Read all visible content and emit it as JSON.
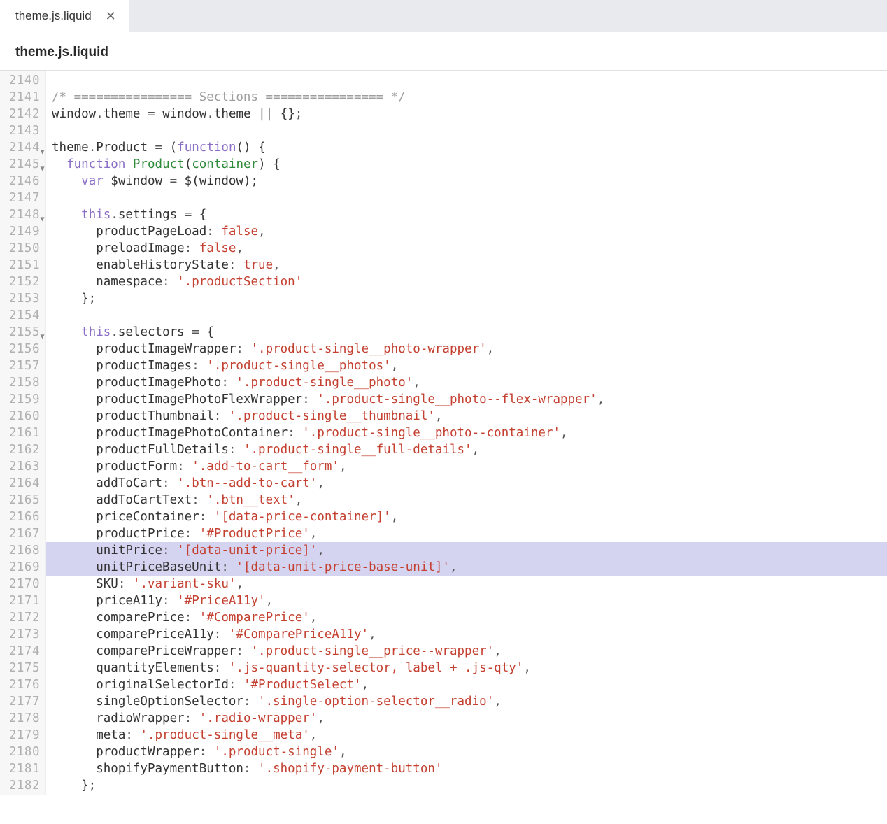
{
  "tab": {
    "label": "theme.js.liquid"
  },
  "breadcrumb": {
    "title": "theme.js.liquid"
  },
  "editor": {
    "highlighted_lines": [
      2168,
      2169
    ],
    "fold_lines": [
      2144,
      2145,
      2148,
      2155
    ],
    "lines": [
      {
        "n": 2140,
        "tokens": []
      },
      {
        "n": 2141,
        "tokens": [
          {
            "t": "/* ================ Sections ================ */",
            "c": "comment"
          }
        ]
      },
      {
        "n": 2142,
        "tokens": [
          {
            "t": "window",
            "c": "plain"
          },
          {
            "t": ".",
            "c": "op"
          },
          {
            "t": "theme",
            "c": "plain"
          },
          {
            "t": " ",
            "c": "plain"
          },
          {
            "t": "=",
            "c": "op"
          },
          {
            "t": " ",
            "c": "plain"
          },
          {
            "t": "window",
            "c": "plain"
          },
          {
            "t": ".",
            "c": "op"
          },
          {
            "t": "theme",
            "c": "plain"
          },
          {
            "t": " ",
            "c": "plain"
          },
          {
            "t": "||",
            "c": "op"
          },
          {
            "t": " ",
            "c": "plain"
          },
          {
            "t": "{}",
            "c": "plain"
          },
          {
            "t": ";",
            "c": "op"
          }
        ]
      },
      {
        "n": 2143,
        "tokens": []
      },
      {
        "n": 2144,
        "tokens": [
          {
            "t": "theme",
            "c": "plain"
          },
          {
            "t": ".",
            "c": "op"
          },
          {
            "t": "Product",
            "c": "plain"
          },
          {
            "t": " ",
            "c": "plain"
          },
          {
            "t": "=",
            "c": "op"
          },
          {
            "t": " ",
            "c": "plain"
          },
          {
            "t": "(",
            "c": "plain"
          },
          {
            "t": "function",
            "c": "kw"
          },
          {
            "t": "() {",
            "c": "plain"
          }
        ]
      },
      {
        "n": 2145,
        "tokens": [
          {
            "t": "  ",
            "c": "plain"
          },
          {
            "t": "function",
            "c": "kw"
          },
          {
            "t": " ",
            "c": "plain"
          },
          {
            "t": "Product",
            "c": "fn"
          },
          {
            "t": "(",
            "c": "plain"
          },
          {
            "t": "container",
            "c": "fn"
          },
          {
            "t": ") {",
            "c": "plain"
          }
        ]
      },
      {
        "n": 2146,
        "tokens": [
          {
            "t": "    ",
            "c": "plain"
          },
          {
            "t": "var",
            "c": "kw"
          },
          {
            "t": " $window ",
            "c": "plain"
          },
          {
            "t": "=",
            "c": "op"
          },
          {
            "t": " $(window);",
            "c": "plain"
          }
        ]
      },
      {
        "n": 2147,
        "tokens": []
      },
      {
        "n": 2148,
        "tokens": [
          {
            "t": "    ",
            "c": "plain"
          },
          {
            "t": "this",
            "c": "kw"
          },
          {
            "t": ".",
            "c": "op"
          },
          {
            "t": "settings ",
            "c": "plain"
          },
          {
            "t": "=",
            "c": "op"
          },
          {
            "t": " {",
            "c": "plain"
          }
        ]
      },
      {
        "n": 2149,
        "tokens": [
          {
            "t": "      productPageLoad",
            "c": "plain"
          },
          {
            "t": ":",
            "c": "op"
          },
          {
            "t": " ",
            "c": "plain"
          },
          {
            "t": "false",
            "c": "const"
          },
          {
            "t": ",",
            "c": "op"
          }
        ]
      },
      {
        "n": 2150,
        "tokens": [
          {
            "t": "      preloadImage",
            "c": "plain"
          },
          {
            "t": ":",
            "c": "op"
          },
          {
            "t": " ",
            "c": "plain"
          },
          {
            "t": "false",
            "c": "const"
          },
          {
            "t": ",",
            "c": "op"
          }
        ]
      },
      {
        "n": 2151,
        "tokens": [
          {
            "t": "      enableHistoryState",
            "c": "plain"
          },
          {
            "t": ":",
            "c": "op"
          },
          {
            "t": " ",
            "c": "plain"
          },
          {
            "t": "true",
            "c": "const"
          },
          {
            "t": ",",
            "c": "op"
          }
        ]
      },
      {
        "n": 2152,
        "tokens": [
          {
            "t": "      namespace",
            "c": "plain"
          },
          {
            "t": ":",
            "c": "op"
          },
          {
            "t": " ",
            "c": "plain"
          },
          {
            "t": "'.productSection'",
            "c": "str"
          }
        ]
      },
      {
        "n": 2153,
        "tokens": [
          {
            "t": "    };",
            "c": "plain"
          }
        ]
      },
      {
        "n": 2154,
        "tokens": []
      },
      {
        "n": 2155,
        "tokens": [
          {
            "t": "    ",
            "c": "plain"
          },
          {
            "t": "this",
            "c": "kw"
          },
          {
            "t": ".",
            "c": "op"
          },
          {
            "t": "selectors ",
            "c": "plain"
          },
          {
            "t": "=",
            "c": "op"
          },
          {
            "t": " {",
            "c": "plain"
          }
        ]
      },
      {
        "n": 2156,
        "tokens": [
          {
            "t": "      productImageWrapper",
            "c": "plain"
          },
          {
            "t": ":",
            "c": "op"
          },
          {
            "t": " ",
            "c": "plain"
          },
          {
            "t": "'.product-single__photo-wrapper'",
            "c": "str"
          },
          {
            "t": ",",
            "c": "op"
          }
        ]
      },
      {
        "n": 2157,
        "tokens": [
          {
            "t": "      productImages",
            "c": "plain"
          },
          {
            "t": ":",
            "c": "op"
          },
          {
            "t": " ",
            "c": "plain"
          },
          {
            "t": "'.product-single__photos'",
            "c": "str"
          },
          {
            "t": ",",
            "c": "op"
          }
        ]
      },
      {
        "n": 2158,
        "tokens": [
          {
            "t": "      productImagePhoto",
            "c": "plain"
          },
          {
            "t": ":",
            "c": "op"
          },
          {
            "t": " ",
            "c": "plain"
          },
          {
            "t": "'.product-single__photo'",
            "c": "str"
          },
          {
            "t": ",",
            "c": "op"
          }
        ]
      },
      {
        "n": 2159,
        "tokens": [
          {
            "t": "      productImagePhotoFlexWrapper",
            "c": "plain"
          },
          {
            "t": ":",
            "c": "op"
          },
          {
            "t": " ",
            "c": "plain"
          },
          {
            "t": "'.product-single__photo--flex-wrapper'",
            "c": "str"
          },
          {
            "t": ",",
            "c": "op"
          }
        ]
      },
      {
        "n": 2160,
        "tokens": [
          {
            "t": "      productThumbnail",
            "c": "plain"
          },
          {
            "t": ":",
            "c": "op"
          },
          {
            "t": " ",
            "c": "plain"
          },
          {
            "t": "'.product-single__thumbnail'",
            "c": "str"
          },
          {
            "t": ",",
            "c": "op"
          }
        ]
      },
      {
        "n": 2161,
        "tokens": [
          {
            "t": "      productImagePhotoContainer",
            "c": "plain"
          },
          {
            "t": ":",
            "c": "op"
          },
          {
            "t": " ",
            "c": "plain"
          },
          {
            "t": "'.product-single__photo--container'",
            "c": "str"
          },
          {
            "t": ",",
            "c": "op"
          }
        ]
      },
      {
        "n": 2162,
        "tokens": [
          {
            "t": "      productFullDetails",
            "c": "plain"
          },
          {
            "t": ":",
            "c": "op"
          },
          {
            "t": " ",
            "c": "plain"
          },
          {
            "t": "'.product-single__full-details'",
            "c": "str"
          },
          {
            "t": ",",
            "c": "op"
          }
        ]
      },
      {
        "n": 2163,
        "tokens": [
          {
            "t": "      productForm",
            "c": "plain"
          },
          {
            "t": ":",
            "c": "op"
          },
          {
            "t": " ",
            "c": "plain"
          },
          {
            "t": "'.add-to-cart__form'",
            "c": "str"
          },
          {
            "t": ",",
            "c": "op"
          }
        ]
      },
      {
        "n": 2164,
        "tokens": [
          {
            "t": "      addToCart",
            "c": "plain"
          },
          {
            "t": ":",
            "c": "op"
          },
          {
            "t": " ",
            "c": "plain"
          },
          {
            "t": "'.btn--add-to-cart'",
            "c": "str"
          },
          {
            "t": ",",
            "c": "op"
          }
        ]
      },
      {
        "n": 2165,
        "tokens": [
          {
            "t": "      addToCartText",
            "c": "plain"
          },
          {
            "t": ":",
            "c": "op"
          },
          {
            "t": " ",
            "c": "plain"
          },
          {
            "t": "'.btn__text'",
            "c": "str"
          },
          {
            "t": ",",
            "c": "op"
          }
        ]
      },
      {
        "n": 2166,
        "tokens": [
          {
            "t": "      priceContainer",
            "c": "plain"
          },
          {
            "t": ":",
            "c": "op"
          },
          {
            "t": " ",
            "c": "plain"
          },
          {
            "t": "'[data-price-container]'",
            "c": "str"
          },
          {
            "t": ",",
            "c": "op"
          }
        ]
      },
      {
        "n": 2167,
        "tokens": [
          {
            "t": "      productPrice",
            "c": "plain"
          },
          {
            "t": ":",
            "c": "op"
          },
          {
            "t": " ",
            "c": "plain"
          },
          {
            "t": "'#ProductPrice'",
            "c": "str"
          },
          {
            "t": ",",
            "c": "op"
          }
        ]
      },
      {
        "n": 2168,
        "tokens": [
          {
            "t": "      unitPrice",
            "c": "plain"
          },
          {
            "t": ":",
            "c": "op"
          },
          {
            "t": " ",
            "c": "plain"
          },
          {
            "t": "'[data-unit-price]'",
            "c": "str"
          },
          {
            "t": ",",
            "c": "op"
          }
        ]
      },
      {
        "n": 2169,
        "tokens": [
          {
            "t": "      unitPriceBaseUnit",
            "c": "plain"
          },
          {
            "t": ":",
            "c": "op"
          },
          {
            "t": " ",
            "c": "plain"
          },
          {
            "t": "'[data-unit-price-base-unit]'",
            "c": "str"
          },
          {
            "t": ",",
            "c": "op"
          }
        ]
      },
      {
        "n": 2170,
        "tokens": [
          {
            "t": "      SKU",
            "c": "plain"
          },
          {
            "t": ":",
            "c": "op"
          },
          {
            "t": " ",
            "c": "plain"
          },
          {
            "t": "'.variant-sku'",
            "c": "str"
          },
          {
            "t": ",",
            "c": "op"
          }
        ]
      },
      {
        "n": 2171,
        "tokens": [
          {
            "t": "      priceA11y",
            "c": "plain"
          },
          {
            "t": ":",
            "c": "op"
          },
          {
            "t": " ",
            "c": "plain"
          },
          {
            "t": "'#PriceA11y'",
            "c": "str"
          },
          {
            "t": ",",
            "c": "op"
          }
        ]
      },
      {
        "n": 2172,
        "tokens": [
          {
            "t": "      comparePrice",
            "c": "plain"
          },
          {
            "t": ":",
            "c": "op"
          },
          {
            "t": " ",
            "c": "plain"
          },
          {
            "t": "'#ComparePrice'",
            "c": "str"
          },
          {
            "t": ",",
            "c": "op"
          }
        ]
      },
      {
        "n": 2173,
        "tokens": [
          {
            "t": "      comparePriceA11y",
            "c": "plain"
          },
          {
            "t": ":",
            "c": "op"
          },
          {
            "t": " ",
            "c": "plain"
          },
          {
            "t": "'#ComparePriceA11y'",
            "c": "str"
          },
          {
            "t": ",",
            "c": "op"
          }
        ]
      },
      {
        "n": 2174,
        "tokens": [
          {
            "t": "      comparePriceWrapper",
            "c": "plain"
          },
          {
            "t": ":",
            "c": "op"
          },
          {
            "t": " ",
            "c": "plain"
          },
          {
            "t": "'.product-single__price--wrapper'",
            "c": "str"
          },
          {
            "t": ",",
            "c": "op"
          }
        ]
      },
      {
        "n": 2175,
        "tokens": [
          {
            "t": "      quantityElements",
            "c": "plain"
          },
          {
            "t": ":",
            "c": "op"
          },
          {
            "t": " ",
            "c": "plain"
          },
          {
            "t": "'.js-quantity-selector, label + .js-qty'",
            "c": "str"
          },
          {
            "t": ",",
            "c": "op"
          }
        ]
      },
      {
        "n": 2176,
        "tokens": [
          {
            "t": "      originalSelectorId",
            "c": "plain"
          },
          {
            "t": ":",
            "c": "op"
          },
          {
            "t": " ",
            "c": "plain"
          },
          {
            "t": "'#ProductSelect'",
            "c": "str"
          },
          {
            "t": ",",
            "c": "op"
          }
        ]
      },
      {
        "n": 2177,
        "tokens": [
          {
            "t": "      singleOptionSelector",
            "c": "plain"
          },
          {
            "t": ":",
            "c": "op"
          },
          {
            "t": " ",
            "c": "plain"
          },
          {
            "t": "'.single-option-selector__radio'",
            "c": "str"
          },
          {
            "t": ",",
            "c": "op"
          }
        ]
      },
      {
        "n": 2178,
        "tokens": [
          {
            "t": "      radioWrapper",
            "c": "plain"
          },
          {
            "t": ":",
            "c": "op"
          },
          {
            "t": " ",
            "c": "plain"
          },
          {
            "t": "'.radio-wrapper'",
            "c": "str"
          },
          {
            "t": ",",
            "c": "op"
          }
        ]
      },
      {
        "n": 2179,
        "tokens": [
          {
            "t": "      meta",
            "c": "plain"
          },
          {
            "t": ":",
            "c": "op"
          },
          {
            "t": " ",
            "c": "plain"
          },
          {
            "t": "'.product-single__meta'",
            "c": "str"
          },
          {
            "t": ",",
            "c": "op"
          }
        ]
      },
      {
        "n": 2180,
        "tokens": [
          {
            "t": "      productWrapper",
            "c": "plain"
          },
          {
            "t": ":",
            "c": "op"
          },
          {
            "t": " ",
            "c": "plain"
          },
          {
            "t": "'.product-single'",
            "c": "str"
          },
          {
            "t": ",",
            "c": "op"
          }
        ]
      },
      {
        "n": 2181,
        "tokens": [
          {
            "t": "      shopifyPaymentButton",
            "c": "plain"
          },
          {
            "t": ":",
            "c": "op"
          },
          {
            "t": " ",
            "c": "plain"
          },
          {
            "t": "'.shopify-payment-button'",
            "c": "str"
          }
        ]
      },
      {
        "n": 2182,
        "tokens": [
          {
            "t": "    };",
            "c": "plain"
          }
        ]
      }
    ]
  }
}
